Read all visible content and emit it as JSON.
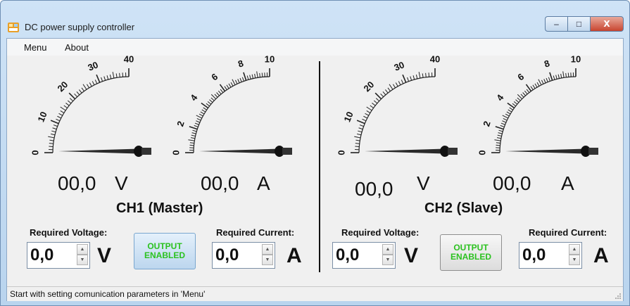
{
  "window": {
    "title": "DC power supply controller",
    "minimize": "–",
    "maximize": "□",
    "close": "X"
  },
  "menu": {
    "items": [
      "Menu",
      "About"
    ]
  },
  "ch1": {
    "title": "CH1 (Master)",
    "voltmeter": {
      "ticks": [
        "0",
        "10",
        "20",
        "30",
        "40"
      ],
      "reading": "00,0",
      "unit": "V",
      "value": 0
    },
    "ammeter": {
      "ticks": [
        "0",
        "2",
        "4",
        "6",
        "8",
        "10"
      ],
      "reading": "00,0",
      "unit": "A",
      "value": 0
    },
    "required_voltage": {
      "label": "Required Voltage:",
      "value": "0,0",
      "unit": "V"
    },
    "output_button": {
      "line1": "OUTPUT",
      "line2": "ENABLED"
    },
    "required_current": {
      "label": "Required Current:",
      "value": "0,0",
      "unit": "A"
    }
  },
  "ch2": {
    "title": "CH2 (Slave)",
    "voltmeter": {
      "ticks": [
        "0",
        "10",
        "20",
        "30",
        "40"
      ],
      "reading": "00,0",
      "unit": "V",
      "value": 0
    },
    "ammeter": {
      "ticks": [
        "0",
        "2",
        "4",
        "6",
        "8",
        "10"
      ],
      "reading": "00,0",
      "unit": "A",
      "value": 0
    },
    "required_voltage": {
      "label": "Required Voltage:",
      "value": "0,0",
      "unit": "V"
    },
    "output_button": {
      "line1": "OUTPUT",
      "line2": "ENABLED"
    },
    "required_current": {
      "label": "Required Current:",
      "value": "0,0",
      "unit": "A"
    }
  },
  "status": {
    "text": "Start with setting comunication parameters in 'Menu'"
  },
  "colors": {
    "output_enabled_text": "#2bc21f"
  }
}
